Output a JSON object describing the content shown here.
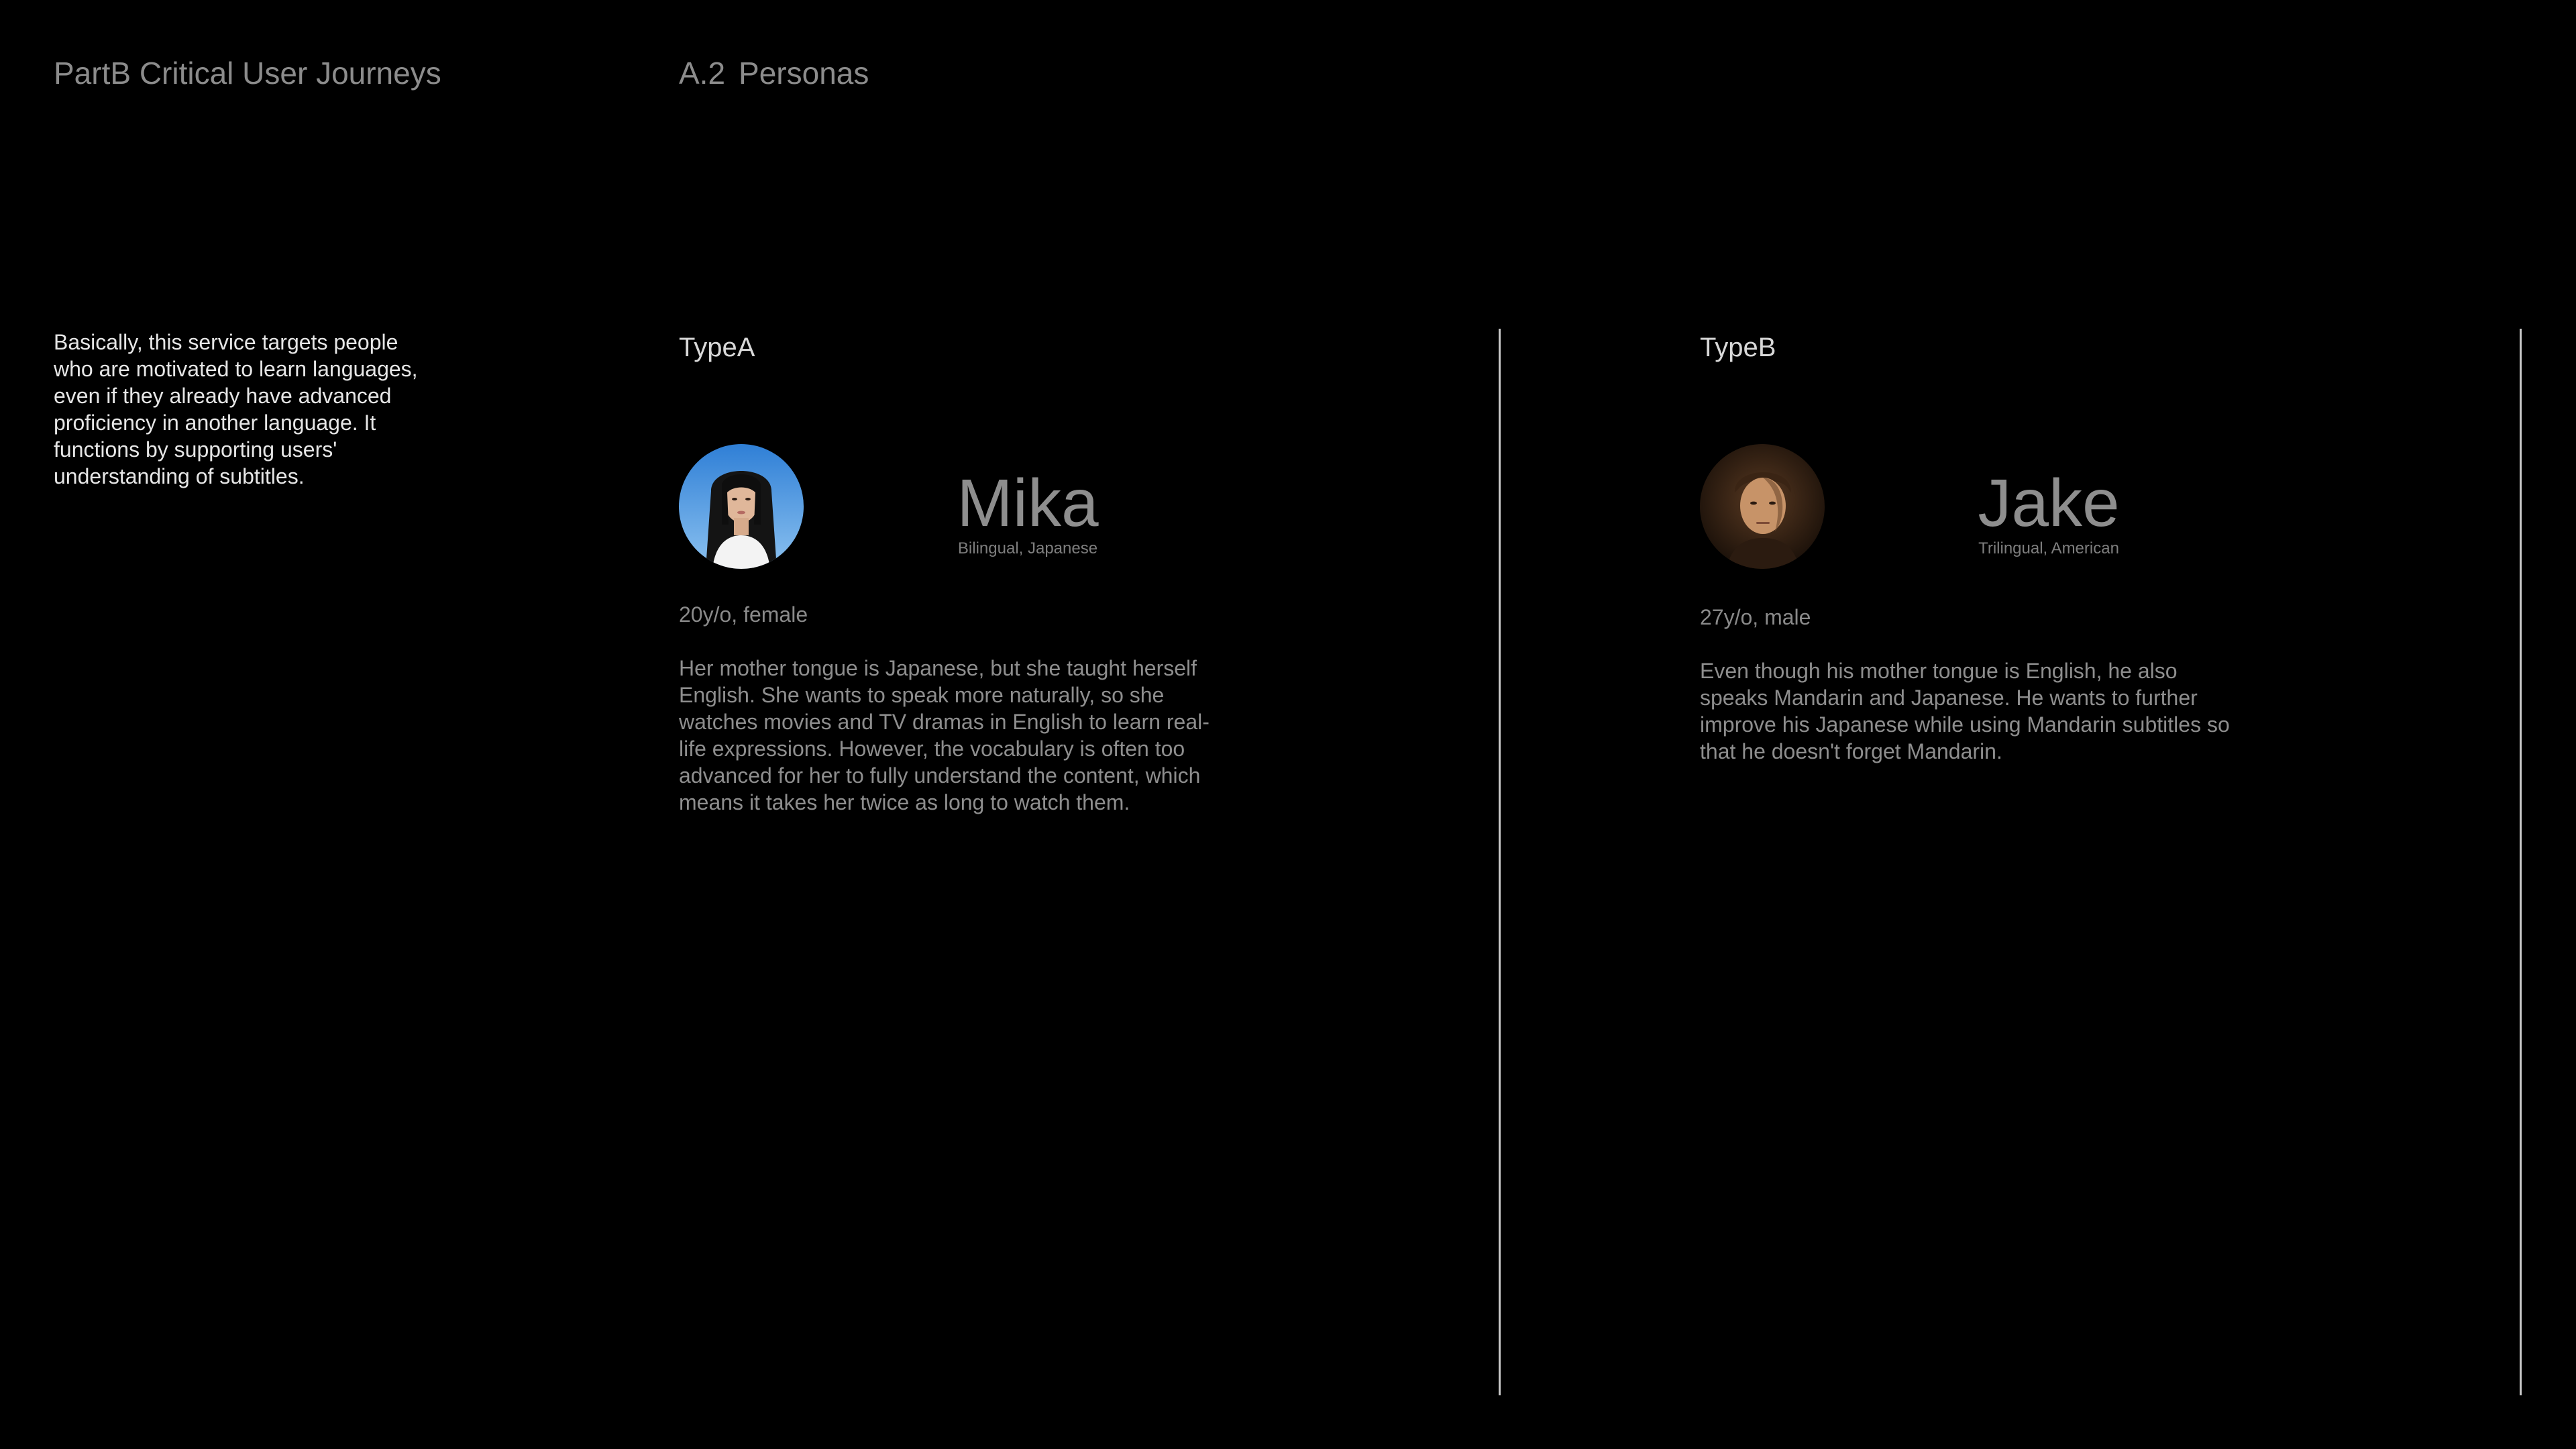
{
  "header": {
    "title": "PartB Critical User Journeys",
    "section_number": "A.2",
    "section_title": "Personas"
  },
  "intro": {
    "text": "Basically, this service targets people\nwho are motivated to learn languages,\neven if they already have advanced\nproficiency in another language. It\nfunctions by supporting users'\nunderstanding of subtitles."
  },
  "personas": [
    {
      "type": "TypeA",
      "name": "Mika",
      "tagline": "Bilingual, Japanese",
      "age": "20y/o, female",
      "bio": "Her mother tongue is Japanese, but she taught herself\nEnglish. She wants to speak more naturally, so she\nwatches movies and TV dramas in English to learn real-\nlife expressions. However, the vocabulary is often too\nadvanced for her to fully understand the content, which\nmeans it takes her twice as long to watch them.",
      "avatar_icon": "avatar-photo-woman"
    },
    {
      "type": "TypeB",
      "name": "Jake",
      "tagline": "Trilingual, American",
      "age": "27y/o, male",
      "bio": "Even though his mother tongue is English, he also\nspeaks Mandarin and Japanese. He wants to further\nimprove his Japanese while using Mandarin subtitles so\nthat he doesn't forget Mandarin.",
      "avatar_icon": "avatar-photo-man"
    }
  ],
  "colors": {
    "background": "#000000",
    "muted_text": "#8c8c8c",
    "light_text": "#e6e6e6",
    "divider": "#c8c8c8",
    "avatar_sky": "#4a8fd8"
  }
}
